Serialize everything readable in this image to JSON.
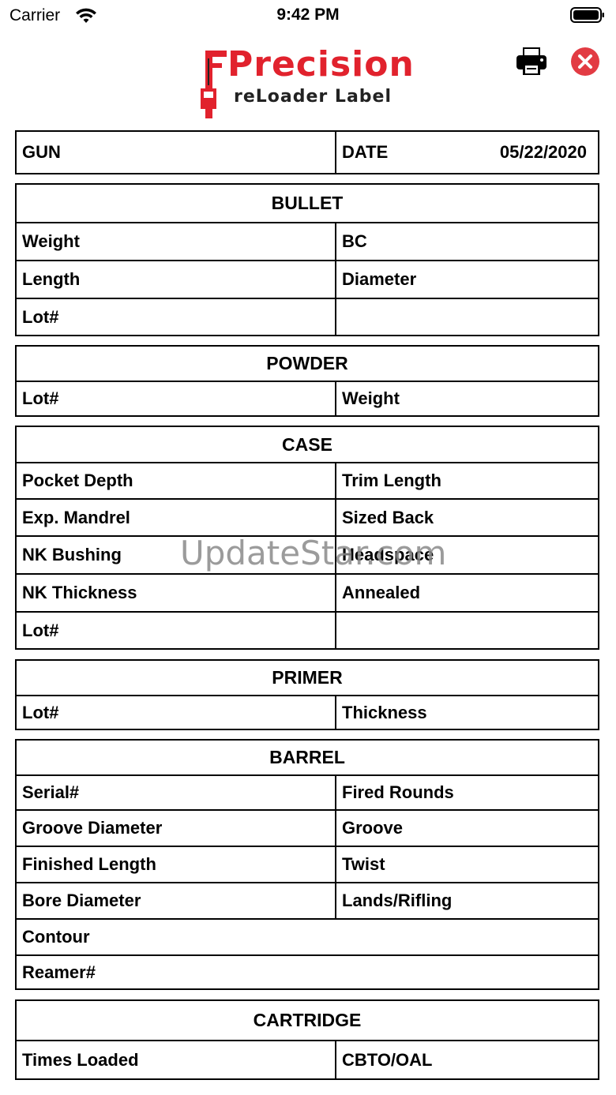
{
  "status_bar": {
    "carrier": "Carrier",
    "time": "9:42 PM"
  },
  "logo": {
    "title": "Precision",
    "subtitle": "reLoader Label"
  },
  "watermark": "UpdateStar.com",
  "header_row": {
    "gun_label": "GUN",
    "date_label": "DATE",
    "date_value": "05/22/2020"
  },
  "sections": {
    "bullet": {
      "title": "BULLET",
      "rows": [
        [
          "Weight",
          "BC"
        ],
        [
          "Length",
          "Diameter"
        ],
        [
          "Lot#",
          ""
        ]
      ]
    },
    "powder": {
      "title": "POWDER",
      "rows": [
        [
          "Lot#",
          "Weight"
        ]
      ]
    },
    "case": {
      "title": "CASE",
      "rows": [
        [
          "Pocket Depth",
          "Trim Length"
        ],
        [
          "Exp. Mandrel",
          "Sized Back"
        ],
        [
          "NK Bushing",
          "Headspace"
        ],
        [
          "NK Thickness",
          "Annealed"
        ],
        [
          "Lot#",
          ""
        ]
      ]
    },
    "primer": {
      "title": "PRIMER",
      "rows": [
        [
          "Lot#",
          "Thickness"
        ]
      ]
    },
    "barrel": {
      "title": "BARREL",
      "rows": [
        [
          "Serial#",
          "Fired Rounds"
        ],
        [
          "Groove Diameter",
          "Groove"
        ],
        [
          "Finished Length",
          "Twist"
        ],
        [
          "Bore Diameter",
          "Lands/Rifling"
        ]
      ],
      "full_rows": [
        "Contour",
        "Reamer#"
      ]
    },
    "cartridge": {
      "title": "CARTRIDGE",
      "rows": [
        [
          "Times Loaded",
          "CBTO/OAL"
        ]
      ]
    }
  },
  "icons": {
    "print": "printer-icon",
    "close": "close-icon",
    "wifi": "wifi-icon",
    "battery": "battery-icon"
  },
  "colors": {
    "brand_red": "#e1222d",
    "close_red": "#e23b43"
  }
}
